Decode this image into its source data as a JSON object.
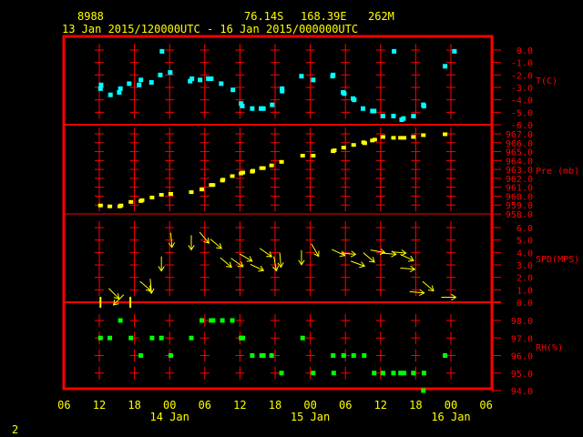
{
  "header": {
    "station_id": "8988",
    "latitude": "76.14S",
    "longitude": "168.39E",
    "elevation": "262M",
    "time_range": "13 Jan 2015/120000UTC - 16 Jan 2015/000000UTC"
  },
  "footer": {
    "page_number": "2"
  },
  "colors": {
    "frame": "#ff0000",
    "temperature": "#00ffff",
    "pressure": "#ffff00",
    "wind": "#ffff00",
    "rh": "#00ff00",
    "text": "#ffff00"
  },
  "chart_data": {
    "type": "scatter",
    "x_axis": {
      "label": "",
      "unit": "hours since 13 Jan 2015 12UTC",
      "range": [
        -6,
        66
      ],
      "tick_hours": [
        -6,
        0,
        6,
        12,
        18,
        24,
        30,
        36,
        42,
        48,
        54,
        60,
        66
      ],
      "tick_labels": [
        "06",
        "12",
        "18",
        "00",
        "06",
        "12",
        "18",
        "00",
        "06",
        "12",
        "18",
        "00",
        "06"
      ],
      "date_labels": [
        {
          "hour": 12,
          "label": "14 Jan"
        },
        {
          "hour": 36,
          "label": "15 Jan"
        },
        {
          "hour": 60,
          "label": "16 Jan"
        }
      ]
    },
    "panels": [
      {
        "name": "temperature",
        "label": "T(C)",
        "range": [
          -6,
          0
        ],
        "ticks": [
          "0.0",
          "-1.0",
          "-2.0",
          "-3.0",
          "-4.0",
          "-5.0",
          "-6.0"
        ],
        "tick_values": [
          0,
          -1,
          -2,
          -3,
          -4,
          -5,
          -6
        ],
        "points": [
          [
            0.2,
            -3.1
          ],
          [
            0.3,
            -2.8
          ],
          [
            1.9,
            -3.6
          ],
          [
            3.4,
            -3.4
          ],
          [
            3.6,
            -3.1
          ],
          [
            5.1,
            -2.7
          ],
          [
            6.8,
            -2.8
          ],
          [
            7.1,
            -2.4
          ],
          [
            8.9,
            -2.6
          ],
          [
            10.4,
            -2.0
          ],
          [
            10.7,
            -0.1
          ],
          [
            12.1,
            -1.8
          ],
          [
            15.5,
            -2.5
          ],
          [
            15.8,
            -2.3
          ],
          [
            17.2,
            -2.4
          ],
          [
            18.6,
            -2.3
          ],
          [
            19.1,
            -2.3
          ],
          [
            20.8,
            -2.7
          ],
          [
            22.8,
            -3.2
          ],
          [
            24.2,
            -4.3
          ],
          [
            24.4,
            -4.5
          ],
          [
            26.1,
            -4.7
          ],
          [
            27.6,
            -4.7
          ],
          [
            28.0,
            -4.7
          ],
          [
            29.5,
            -4.4
          ],
          [
            31.2,
            -3.3
          ],
          [
            31.2,
            -3.1
          ],
          [
            34.5,
            -2.1
          ],
          [
            36.5,
            -2.4
          ],
          [
            39.8,
            -2.1
          ],
          [
            39.9,
            -2.0
          ],
          [
            41.6,
            -3.4
          ],
          [
            41.8,
            -3.5
          ],
          [
            43.3,
            -3.9
          ],
          [
            43.5,
            -4.0
          ],
          [
            45.0,
            -4.7
          ],
          [
            46.6,
            -4.9
          ],
          [
            46.9,
            -4.9
          ],
          [
            48.4,
            -5.3
          ],
          [
            50.2,
            -5.3
          ],
          [
            50.3,
            -0.1
          ],
          [
            51.6,
            -5.6
          ],
          [
            51.9,
            -5.5
          ],
          [
            53.6,
            -5.3
          ],
          [
            55.3,
            -4.4
          ],
          [
            55.4,
            -4.5
          ],
          [
            59.0,
            -1.3
          ],
          [
            60.6,
            -0.1
          ]
        ]
      },
      {
        "name": "pressure",
        "label": "Pre (mb)",
        "range": [
          958,
          967
        ],
        "ticks": [
          "967.0",
          "966.0",
          "965.0",
          "964.0",
          "963.0",
          "962.0",
          "961.0",
          "960.0",
          "959.0",
          "958.0"
        ],
        "tick_values": [
          967,
          966,
          965,
          964,
          963,
          962,
          961,
          960,
          959,
          958
        ],
        "points": [
          [
            0.2,
            958.9
          ],
          [
            1.8,
            958.8
          ],
          [
            3.5,
            958.8
          ],
          [
            3.7,
            958.9
          ],
          [
            5.4,
            959.3
          ],
          [
            7.1,
            959.4
          ],
          [
            7.3,
            959.5
          ],
          [
            9.0,
            959.8
          ],
          [
            10.6,
            960.1
          ],
          [
            12.2,
            960.2
          ],
          [
            15.7,
            960.4
          ],
          [
            17.5,
            960.7
          ],
          [
            19.1,
            961.2
          ],
          [
            19.4,
            961.2
          ],
          [
            21.0,
            961.7
          ],
          [
            21.1,
            961.8
          ],
          [
            22.7,
            962.2
          ],
          [
            24.2,
            962.5
          ],
          [
            24.5,
            962.6
          ],
          [
            26.1,
            962.7
          ],
          [
            26.2,
            962.8
          ],
          [
            27.7,
            963.1
          ],
          [
            28.0,
            963.1
          ],
          [
            29.4,
            963.4
          ],
          [
            31.1,
            963.8
          ],
          [
            34.7,
            964.5
          ],
          [
            36.5,
            964.5
          ],
          [
            39.9,
            965.0
          ],
          [
            40.1,
            965.1
          ],
          [
            41.7,
            965.4
          ],
          [
            43.4,
            965.7
          ],
          [
            45.1,
            966.0
          ],
          [
            45.3,
            965.9
          ],
          [
            46.6,
            966.2
          ],
          [
            47.0,
            966.3
          ],
          [
            48.4,
            966.6
          ],
          [
            50.2,
            966.5
          ],
          [
            51.4,
            966.5
          ],
          [
            52.0,
            966.5
          ],
          [
            53.6,
            966.6
          ],
          [
            55.3,
            966.8
          ],
          [
            59.0,
            966.9
          ]
        ]
      },
      {
        "name": "wind_speed",
        "label": "SPD(MPS)",
        "range": [
          0,
          6
        ],
        "ticks": [
          "6.0",
          "5.0",
          "4.0",
          "3.0",
          "2.0",
          "1.0",
          "0.0"
        ],
        "tick_values": [
          6,
          5,
          4,
          3,
          2,
          1,
          0
        ],
        "arrow_direction_note": "arrow angle in degrees, 0=pointing right, 90=pointing down",
        "points": [
          [
            0.2,
            0.0,
            null
          ],
          [
            2.5,
            0.7,
            45
          ],
          [
            3.3,
            0.2,
            135
          ],
          [
            5.3,
            0.0,
            null
          ],
          [
            7.9,
            1.3,
            40
          ],
          [
            8.8,
            1.3,
            85
          ],
          [
            10.6,
            3.1,
            90
          ],
          [
            12.3,
            5.0,
            85
          ],
          [
            15.7,
            4.8,
            90
          ],
          [
            17.9,
            5.2,
            50
          ],
          [
            19.9,
            4.7,
            40
          ],
          [
            21.6,
            3.2,
            40
          ],
          [
            23.5,
            3.2,
            35
          ],
          [
            25.0,
            3.6,
            30
          ],
          [
            26.9,
            2.8,
            25
          ],
          [
            28.4,
            4.0,
            35
          ],
          [
            30.0,
            3.1,
            80
          ],
          [
            30.9,
            3.4,
            85
          ],
          [
            34.5,
            3.6,
            90
          ],
          [
            36.8,
            4.2,
            60
          ],
          [
            40.8,
            4.0,
            25
          ],
          [
            42.5,
            3.9,
            5
          ],
          [
            44.1,
            3.1,
            20
          ],
          [
            46.0,
            3.6,
            40
          ],
          [
            47.5,
            4.1,
            10
          ],
          [
            49.4,
            3.9,
            5
          ],
          [
            51.1,
            4.0,
            5
          ],
          [
            52.5,
            3.6,
            25
          ],
          [
            52.6,
            2.7,
            5
          ],
          [
            56.1,
            1.3,
            40
          ],
          [
            54.2,
            0.8,
            5
          ],
          [
            59.6,
            0.4,
            0
          ]
        ]
      },
      {
        "name": "relative_humidity",
        "label": "RH(%)",
        "range": [
          94,
          98
        ],
        "ticks": [
          "98.0",
          "97.0",
          "96.0",
          "95.0",
          "94.0"
        ],
        "tick_values": [
          98,
          97,
          96,
          95,
          94
        ],
        "points": [
          [
            3.6,
            98
          ],
          [
            17.5,
            98
          ],
          [
            19.1,
            98
          ],
          [
            19.4,
            98
          ],
          [
            21.0,
            98
          ],
          [
            22.7,
            98
          ],
          [
            0.2,
            97
          ],
          [
            1.8,
            97
          ],
          [
            5.4,
            97
          ],
          [
            9.0,
            97
          ],
          [
            10.6,
            97
          ],
          [
            15.7,
            97
          ],
          [
            24.2,
            97
          ],
          [
            24.5,
            97
          ],
          [
            34.7,
            97
          ],
          [
            7.1,
            96
          ],
          [
            12.2,
            96
          ],
          [
            26.1,
            96
          ],
          [
            27.7,
            96
          ],
          [
            28.0,
            96
          ],
          [
            29.4,
            96
          ],
          [
            39.9,
            96
          ],
          [
            41.7,
            96
          ],
          [
            43.4,
            96
          ],
          [
            45.2,
            96
          ],
          [
            59.0,
            96
          ],
          [
            31.1,
            95
          ],
          [
            36.5,
            95
          ],
          [
            40.0,
            95
          ],
          [
            46.9,
            95
          ],
          [
            48.4,
            95
          ],
          [
            50.2,
            95
          ],
          [
            51.4,
            95
          ],
          [
            52.0,
            95
          ],
          [
            53.6,
            95
          ],
          [
            55.4,
            95
          ],
          [
            55.3,
            94
          ]
        ]
      }
    ]
  }
}
